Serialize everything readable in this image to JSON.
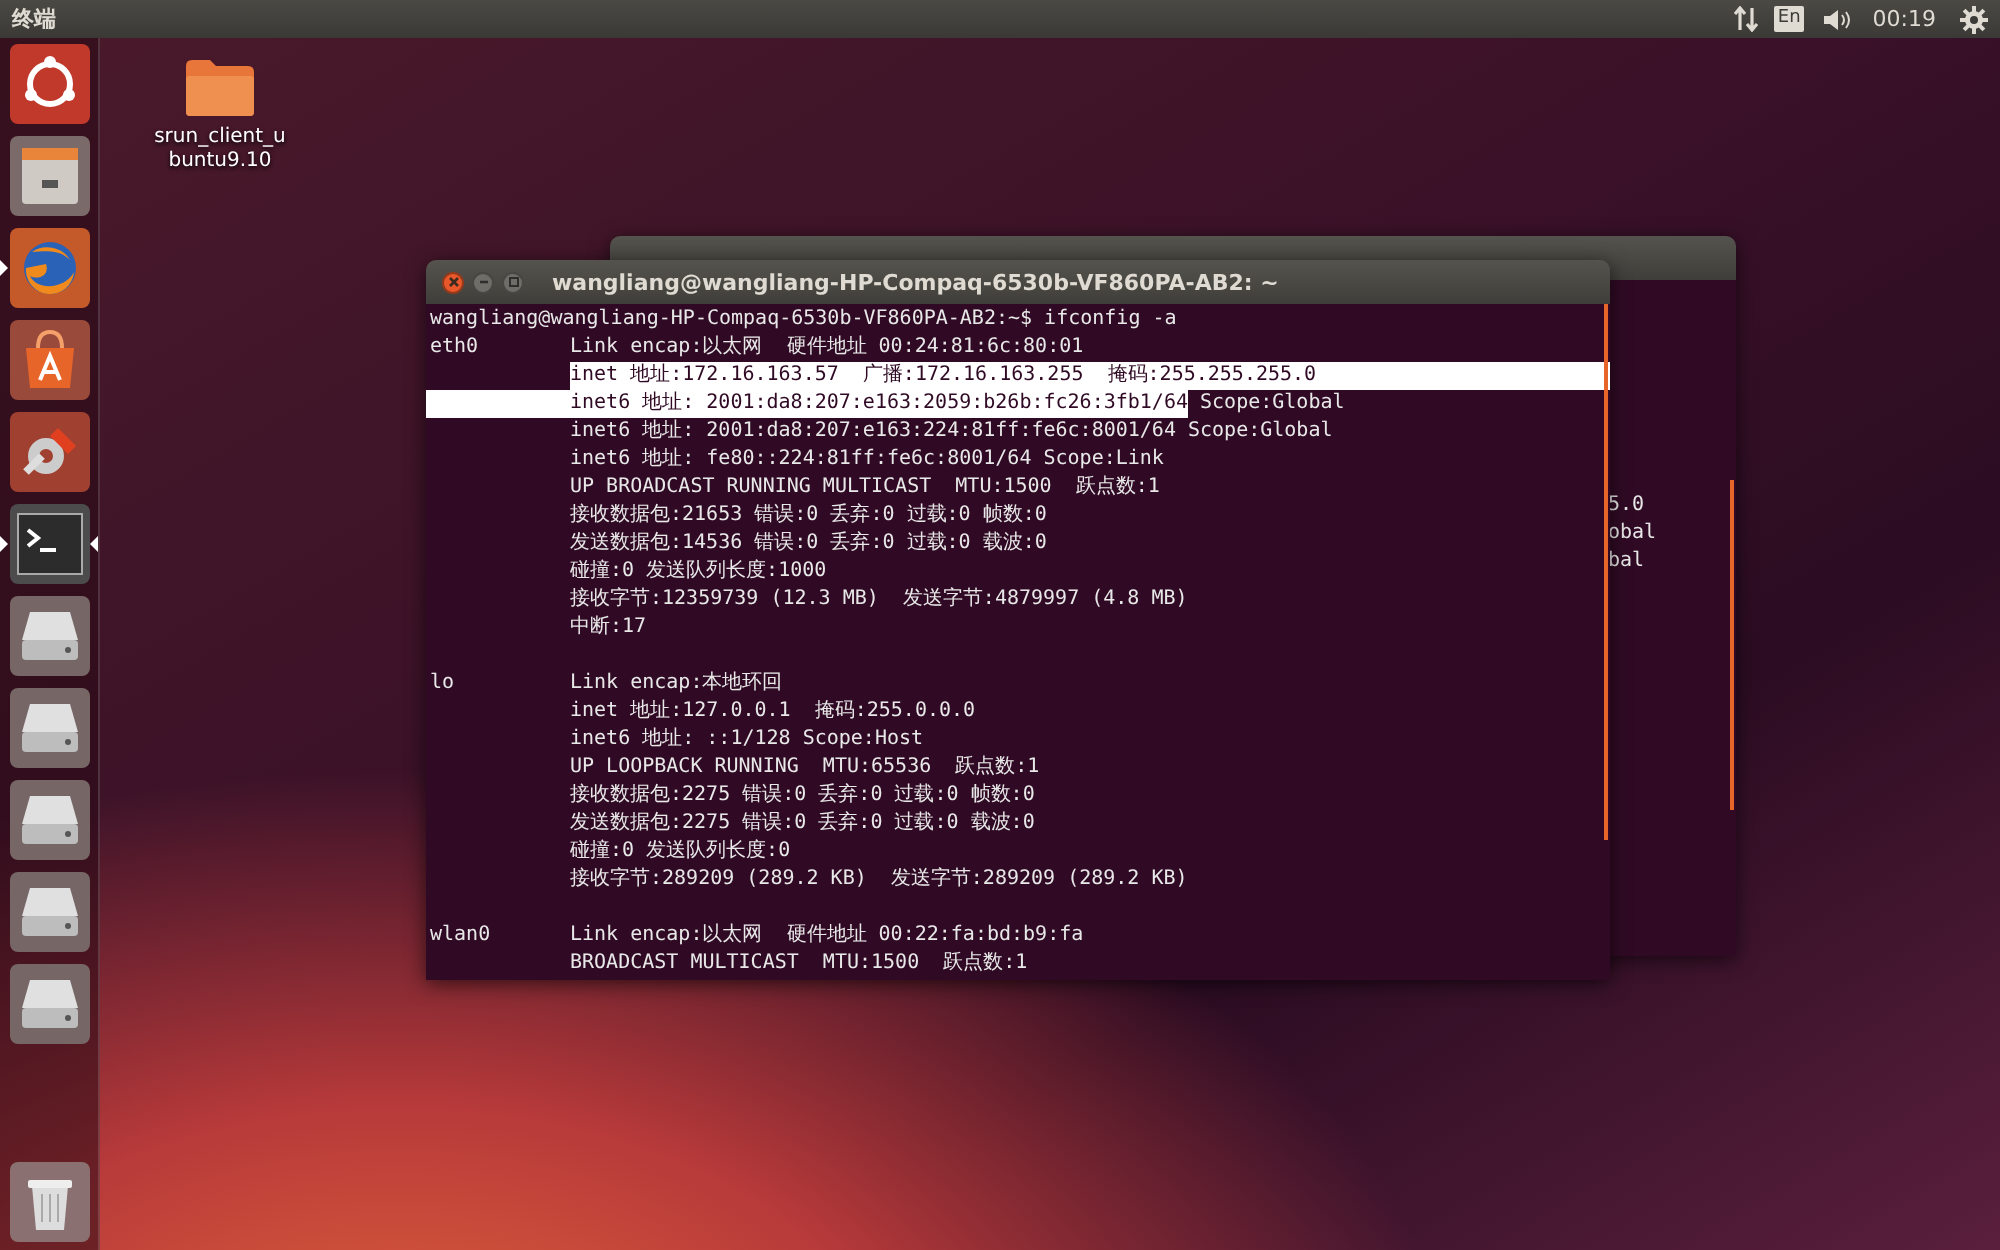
{
  "top_bar": {
    "app_title": "终端",
    "keyboard_layout": "En",
    "clock": "00:19"
  },
  "launcher": [
    {
      "kind": "dash",
      "running": false,
      "focused": false
    },
    {
      "kind": "files",
      "running": false,
      "focused": false
    },
    {
      "kind": "browser",
      "running": true,
      "focused": false
    },
    {
      "kind": "store",
      "running": false,
      "focused": false
    },
    {
      "kind": "settings",
      "running": false,
      "focused": false
    },
    {
      "kind": "terminal",
      "running": true,
      "focused": true
    },
    {
      "kind": "drive",
      "running": false,
      "focused": false
    },
    {
      "kind": "drive",
      "running": false,
      "focused": false
    },
    {
      "kind": "drive",
      "running": false,
      "focused": false
    },
    {
      "kind": "drive",
      "running": false,
      "focused": false
    },
    {
      "kind": "drive",
      "running": false,
      "focused": false
    },
    {
      "kind": "trash",
      "running": false,
      "focused": false
    }
  ],
  "desktop_icons": [
    {
      "label": "srun_client_ubuntu9.10"
    }
  ],
  "back_window": {
    "lines": [
      "5.0",
      "obal",
      "bal"
    ]
  },
  "front_window": {
    "title": "wangliang@wangliang-HP-Compaq-6530b-VF860PA-AB2: ~",
    "lines": [
      {
        "text": "wangliang@wangliang-HP-Compaq-6530b-VF860PA-AB2:~$ ifconfig -a",
        "selected": false,
        "kind": "prompt"
      },
      {
        "iface": "eth0",
        "text": "Link encap:以太网  硬件地址 00:24:81:6c:80:01",
        "selected": false,
        "kind": "output"
      },
      {
        "text": "inet 地址:172.16.163.57  广播:172.16.163.255  掩码:255.255.255.0",
        "selected": true,
        "kind": "output"
      },
      {
        "text": "inet6 地址: 2001:da8:207:e163:2059:b26b:fc26:3fb1/64",
        "after": " Scope:Global",
        "selected": true,
        "kind": "output"
      },
      {
        "text": "inet6 地址: 2001:da8:207:e163:224:81ff:fe6c:8001/64 Scope:Global",
        "selected": false,
        "kind": "output"
      },
      {
        "text": "inet6 地址: fe80::224:81ff:fe6c:8001/64 Scope:Link",
        "selected": false,
        "kind": "output"
      },
      {
        "text": "UP BROADCAST RUNNING MULTICAST  MTU:1500  跃点数:1",
        "selected": false,
        "kind": "output"
      },
      {
        "text": "接收数据包:21653 错误:0 丢弃:0 过载:0 帧数:0",
        "selected": false,
        "kind": "output"
      },
      {
        "text": "发送数据包:14536 错误:0 丢弃:0 过载:0 载波:0",
        "selected": false,
        "kind": "output"
      },
      {
        "text": "碰撞:0 发送队列长度:1000",
        "selected": false,
        "kind": "output"
      },
      {
        "text": "接收字节:12359739 (12.3 MB)  发送字节:4879997 (4.8 MB)",
        "selected": false,
        "kind": "output"
      },
      {
        "text": "中断:17",
        "selected": false,
        "kind": "output"
      },
      {
        "kind": "blank"
      },
      {
        "iface": "lo",
        "text": "Link encap:本地环回",
        "selected": false,
        "kind": "output"
      },
      {
        "text": "inet 地址:127.0.0.1  掩码:255.0.0.0",
        "selected": false,
        "kind": "output"
      },
      {
        "text": "inet6 地址: ::1/128 Scope:Host",
        "selected": false,
        "kind": "output"
      },
      {
        "text": "UP LOOPBACK RUNNING  MTU:65536  跃点数:1",
        "selected": false,
        "kind": "output"
      },
      {
        "text": "接收数据包:2275 错误:0 丢弃:0 过载:0 帧数:0",
        "selected": false,
        "kind": "output"
      },
      {
        "text": "发送数据包:2275 错误:0 丢弃:0 过载:0 载波:0",
        "selected": false,
        "kind": "output"
      },
      {
        "text": "碰撞:0 发送队列长度:0",
        "selected": false,
        "kind": "output"
      },
      {
        "text": "接收字节:289209 (289.2 KB)  发送字节:289209 (289.2 KB)",
        "selected": false,
        "kind": "output"
      },
      {
        "kind": "blank"
      },
      {
        "iface": "wlan0",
        "text": "Link encap:以太网  硬件地址 00:22:fa:bd:b9:fa",
        "selected": false,
        "kind": "output"
      },
      {
        "text": "BROADCAST MULTICAST  MTU:1500  跃点数:1",
        "selected": false,
        "kind": "output"
      }
    ]
  }
}
